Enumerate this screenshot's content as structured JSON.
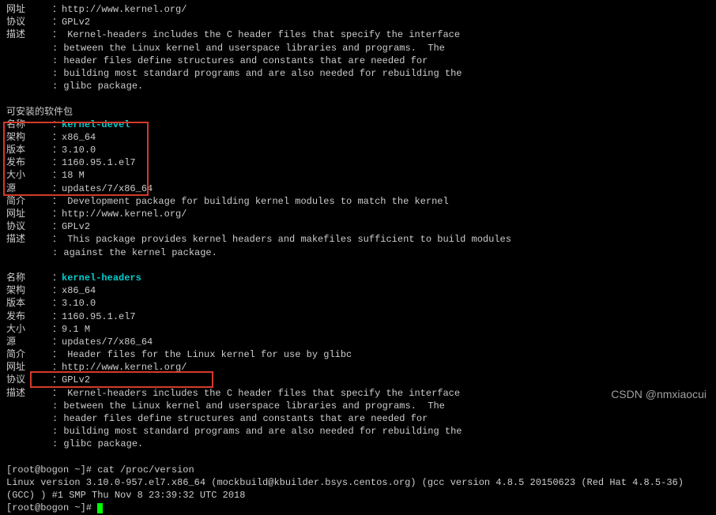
{
  "pkg1": {
    "url_label": "网址",
    "url": "http://www.kernel.org/",
    "license_label": "协议",
    "license": "GPLv2",
    "desc_label": "描述",
    "desc1": "Kernel-headers includes the C header files that specify the interface",
    "desc2": "between the Linux kernel and userspace libraries and programs.  The",
    "desc3": "header files define structures and constants that are needed for",
    "desc4": "building most standard programs and are also needed for rebuilding the",
    "desc5": "glibc package."
  },
  "installable_header": "可安装的软件包",
  "pkg2": {
    "name_label": "名称",
    "name": "kernel-devel",
    "arch_label": "架构",
    "arch": "x86_64",
    "version_label": "版本",
    "version": "3.10.0",
    "release_label": "发布",
    "release": "1160.95.1.el7",
    "size_label": "大小",
    "size": "18 M",
    "repo_label": "源",
    "repo": "updates/7/x86_64",
    "summary_label": "简介",
    "summary": "Development package for building kernel modules to match the kernel",
    "url_label": "网址",
    "url": "http://www.kernel.org/",
    "license_label": "协议",
    "license": "GPLv2",
    "desc_label": "描述",
    "desc1": "This package provides kernel headers and makefiles sufficient to build modules",
    "desc2": "against the kernel package."
  },
  "pkg3": {
    "name_label": "名称",
    "name": "kernel-headers",
    "arch_label": "架构",
    "arch": "x86_64",
    "version_label": "版本",
    "version": "3.10.0",
    "release_label": "发布",
    "release": "1160.95.1.el7",
    "size_label": "大小",
    "size": "9.1 M",
    "repo_label": "源",
    "repo": "updates/7/x86_64",
    "summary_label": "简介",
    "summary": "Header files for the Linux kernel for use by glibc",
    "url_label": "网址",
    "url": "http://www.kernel.org/",
    "license_label": "协议",
    "license": "GPLv2",
    "desc_label": "描述",
    "desc1": "Kernel-headers includes the C header files that specify the interface",
    "desc2": "between the Linux kernel and userspace libraries and programs.  The",
    "desc3": "header files define structures and constants that are needed for",
    "desc4": "building most standard programs and are also needed for rebuilding the",
    "desc5": "glibc package."
  },
  "prompt1": {
    "prefix": "[root@bogon ~]# ",
    "cmd": "cat /proc/version"
  },
  "version_output": "Linux version 3.10.0-957.el7.x86_64 (mockbuild@kbuilder.bsys.centos.org) (gcc version 4.8.5 20150623 (Red Hat 4.8.5-36) (GCC) ) #1 SMP Thu Nov 8 23:39:32 UTC 2018",
  "prompt2": {
    "prefix": "[root@bogon ~]# "
  },
  "watermark": "CSDN @nmxiaocui"
}
